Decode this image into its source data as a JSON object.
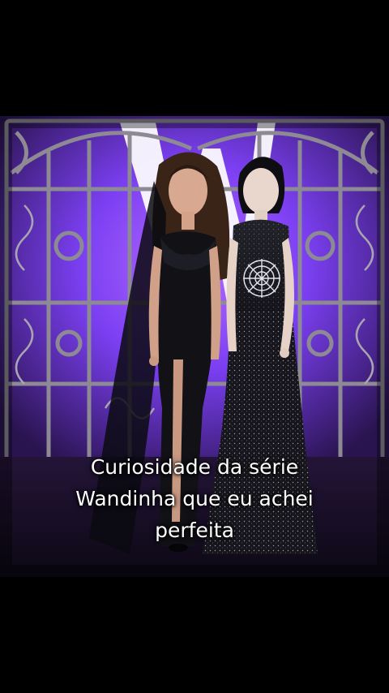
{
  "caption": {
    "line1": "Curiosidade da série",
    "line2": "Wandinha que eu achei",
    "line3": "perfeita"
  },
  "colors": {
    "backdrop_purple": "#7b3ff2",
    "gate_metal": "#8d8a93",
    "letterbox": "#000000",
    "caption_text": "#ffffff"
  },
  "photo": {
    "subject": "two-women-in-gothic-black-gowns-in-front-of-ornate-gate",
    "backdrop_logo": "large-white-W-letter"
  }
}
